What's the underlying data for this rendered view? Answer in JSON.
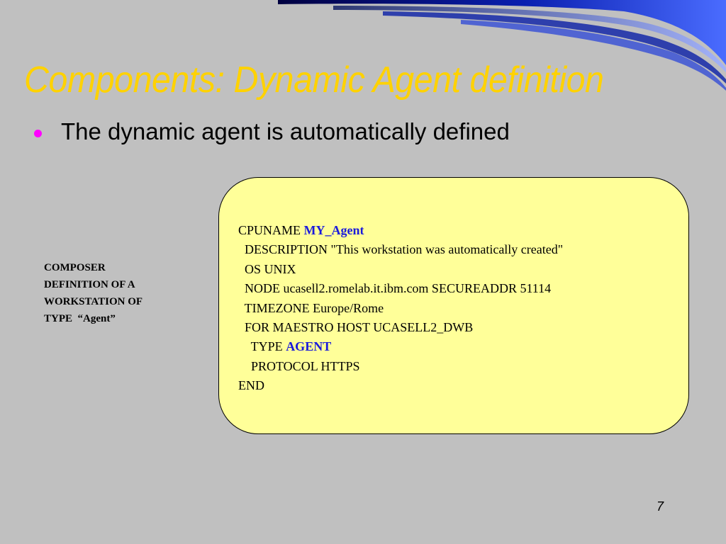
{
  "slide": {
    "title": "Components: Dynamic Agent definition",
    "bullet": "The dynamic agent is automatically defined",
    "page_number": "7"
  },
  "side_note": {
    "lines": [
      "COMPOSER",
      "DEFINITION OF A",
      "WORKSTATION OF",
      "TYPE  “Agent”"
    ]
  },
  "code": {
    "line1_prefix": "CPUNAME ",
    "line1_value": "MY_Agent",
    "line2": "  DESCRIPTION \"This workstation was automatically created\"",
    "line3": "  OS UNIX",
    "line4": "  NODE ucasell2.romelab.it.ibm.com SECUREADDR 51114",
    "line5": "  TIMEZONE Europe/Rome",
    "line6": "  FOR MAESTRO HOST UCASELL2_DWB",
    "line7_prefix": "    TYPE ",
    "line7_value": "AGENT",
    "line8": "    PROTOCOL HTTPS",
    "line9": "END"
  },
  "colors": {
    "background": "#c0c0c0",
    "title": "#ffd200",
    "bullet_dot": "#ff00ff",
    "code_box_fill": "#ffff99",
    "code_highlight": "#1a1adb",
    "swoosh_dark": "#000060",
    "swoosh_light": "#3355ff"
  }
}
